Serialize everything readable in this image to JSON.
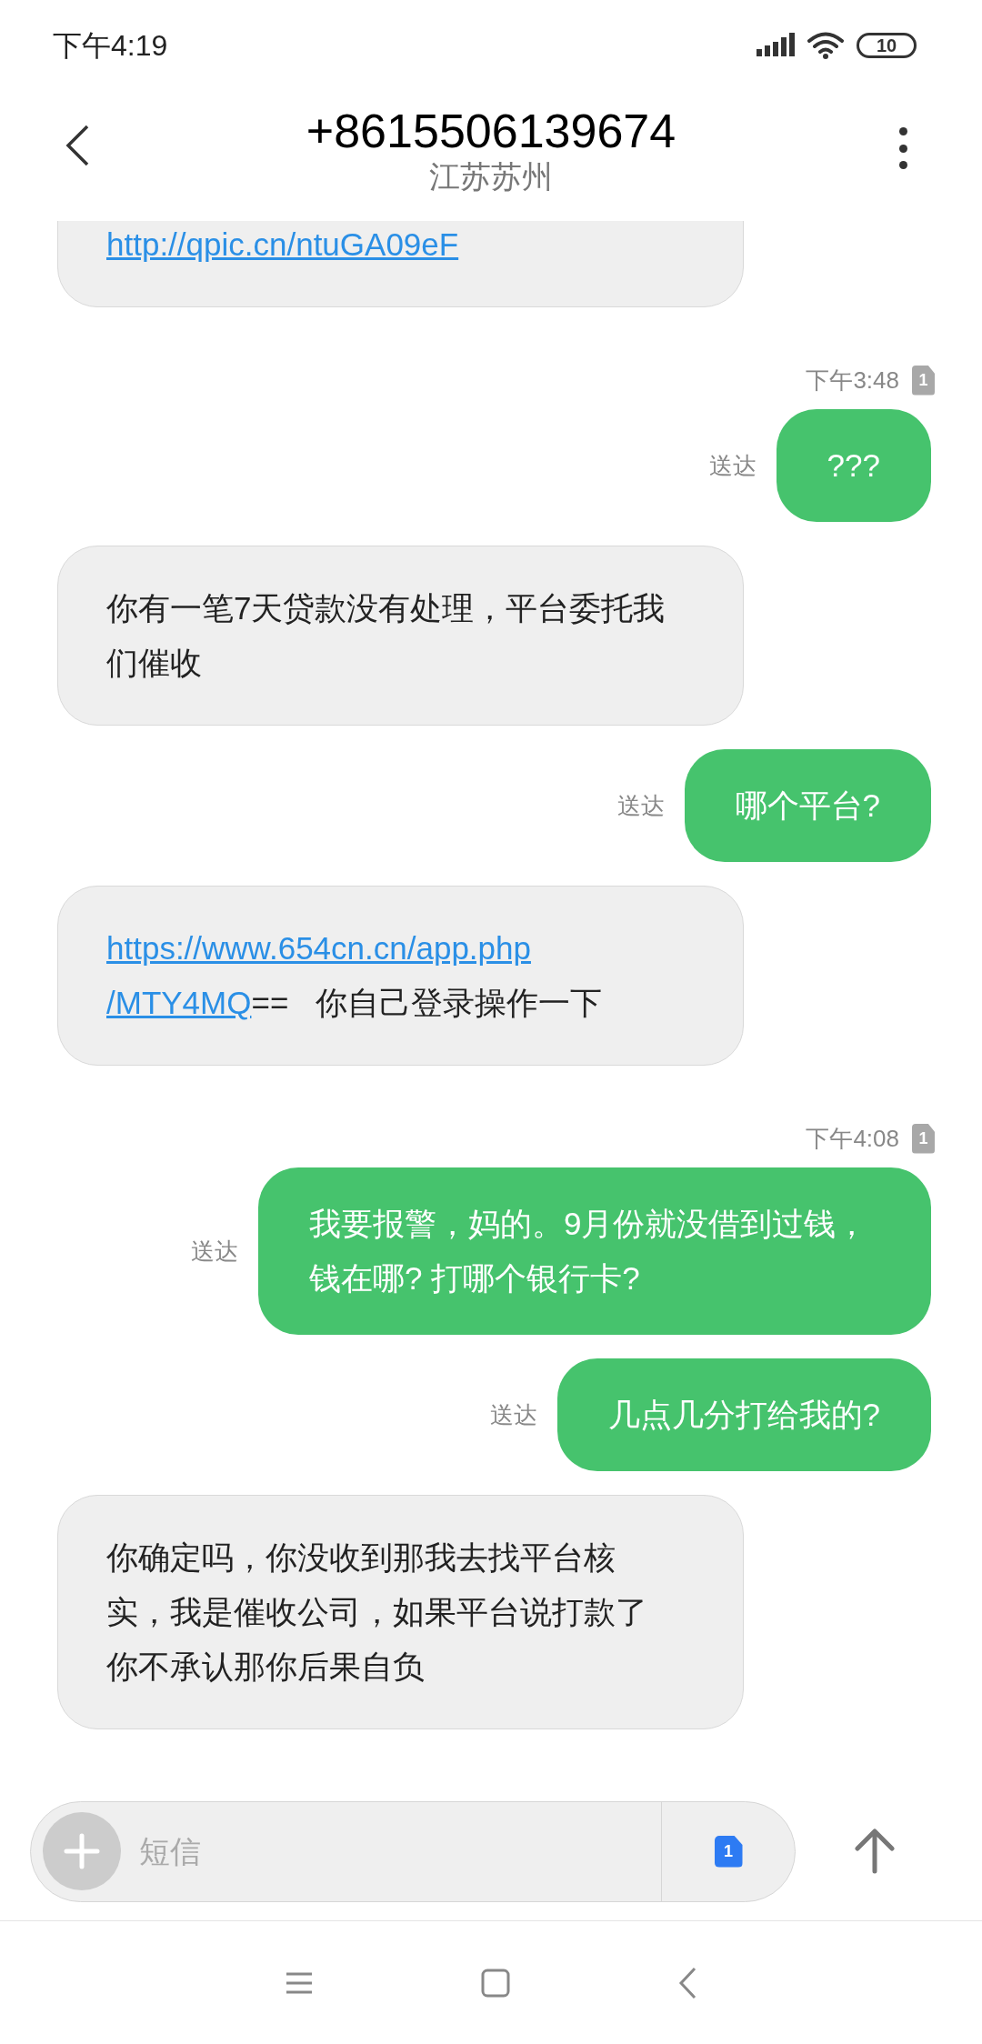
{
  "status_bar": {
    "time": "下午4:19",
    "battery": "10"
  },
  "header": {
    "title": "+8615506139674",
    "subtitle": "江苏苏州"
  },
  "messages": [
    {
      "kind": "received",
      "parts": [
        {
          "kind": "link",
          "text": "http://qpic.cn/ntuGA09eF"
        }
      ]
    },
    {
      "kind": "sent",
      "timestamp": "下午3:48",
      "sim": "1",
      "status": "送达",
      "parts": [
        {
          "kind": "text",
          "text": "???"
        }
      ]
    },
    {
      "kind": "received",
      "parts": [
        {
          "kind": "text",
          "text": "你有一笔7天贷款没有处理，平台委托我们催收"
        }
      ]
    },
    {
      "kind": "sent",
      "status": "送达",
      "parts": [
        {
          "kind": "text",
          "text": "哪个平台?"
        }
      ]
    },
    {
      "kind": "received",
      "parts": [
        {
          "kind": "link",
          "text": "https://www.654cn.cn/app.php"
        },
        {
          "kind": "link",
          "text": "/MTY4MQ"
        },
        {
          "kind": "text",
          "text": "==   你自己登录操作一下"
        }
      ]
    },
    {
      "kind": "sent",
      "timestamp": "下午4:08",
      "sim": "1",
      "status": "送达",
      "parts": [
        {
          "kind": "text",
          "text": "我要报警，妈的。9月份就没借到过钱，钱在哪? 打哪个银行卡?"
        }
      ]
    },
    {
      "kind": "sent",
      "status": "送达",
      "parts": [
        {
          "kind": "text",
          "text": "几点几分打给我的?"
        }
      ]
    },
    {
      "kind": "received",
      "parts": [
        {
          "kind": "text",
          "text": "你确定吗，你没收到那我去找平台核实，我是催收公司，如果平台说打款了你不承认那你后果自负"
        }
      ]
    }
  ],
  "composer": {
    "placeholder": "短信",
    "sim": "1"
  }
}
